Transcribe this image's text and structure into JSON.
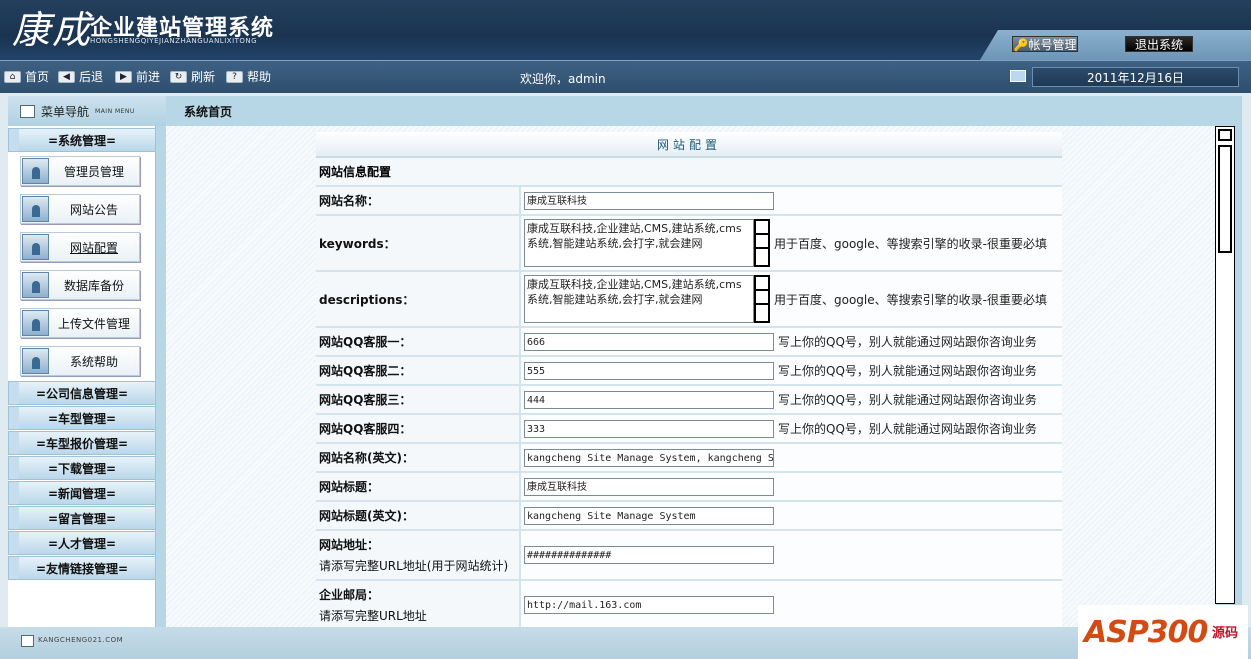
{
  "header": {
    "logo_cn": "康成",
    "logo_title": "企业建站管理系统",
    "logo_pinyin": "HONGSHENGQIYEJIANZHANGUANLIXITONG",
    "account_button": "帐号管理",
    "logout_button": "退出系统"
  },
  "toolbar": {
    "home": "首页",
    "back": "后退",
    "forward": "前进",
    "refresh": "刷新",
    "help": "帮助",
    "welcome": "欢迎你，admin",
    "date": "2011年12月16日"
  },
  "nav": {
    "title": "菜单导航",
    "subtitle": "MAIN MENU",
    "groups": [
      "=系统管理=",
      "=公司信息管理=",
      "=车型管理=",
      "=车型报价管理=",
      "=下载管理=",
      "=新闻管理=",
      "=留言管理=",
      "=人才管理=",
      "=友情链接管理="
    ],
    "items": [
      "管理员管理",
      "网站公告",
      "网站配置",
      "数据库备份",
      "上传文件管理",
      "系统帮助"
    ]
  },
  "content": {
    "page_title": "系统首页",
    "caption": "网站配置",
    "section": "网站信息配置",
    "fields": {
      "site_name": {
        "label": "网站名称：",
        "value": "康成互联科技"
      },
      "keywords": {
        "label": "keywords：",
        "value": "康成互联科技,企业建站,CMS,建站系统,cms系统,智能建站系统,会打字,就会建网",
        "hint": "用于百度、google、等搜索引擎的收录-很重要必填"
      },
      "descriptions": {
        "label": "descriptions：",
        "value": "康成互联科技,企业建站,CMS,建站系统,cms系统,智能建站系统,会打字,就会建网",
        "hint": "用于百度、google、等搜索引擎的收录-很重要必填"
      },
      "qq1": {
        "label": "网站QQ客服一：",
        "value": "666",
        "hint": "写上你的QQ号，别人就能通过网站跟你咨询业务"
      },
      "qq2": {
        "label": "网站QQ客服二：",
        "value": "555",
        "hint": "写上你的QQ号，别人就能通过网站跟你咨询业务"
      },
      "qq3": {
        "label": "网站QQ客服三：",
        "value": "444",
        "hint": "写上你的QQ号，别人就能通过网站跟你咨询业务"
      },
      "qq4": {
        "label": "网站QQ客服四：",
        "value": "333",
        "hint": "写上你的QQ号，别人就能通过网站跟你咨询业务"
      },
      "site_name_en": {
        "label": "网站名称(英文)：",
        "value": "kangcheng Site Manage System, kangcheng S"
      },
      "site_title": {
        "label": "网站标题：",
        "value": "康成互联科技"
      },
      "site_title_en": {
        "label": "网站标题(英文)：",
        "value": "kangcheng Site Manage System"
      },
      "site_url": {
        "label": "网站地址：",
        "sub": "请添写完整URL地址(用于网站统计)",
        "value": "##############"
      },
      "mail": {
        "label": "企业邮局：",
        "sub": "请添写完整URL地址",
        "value": "http://mail.163.com"
      }
    }
  },
  "footer": {
    "text": "KANGCHENG021.COM",
    "watermark": "ASP300",
    "watermark_sub": "源码"
  }
}
